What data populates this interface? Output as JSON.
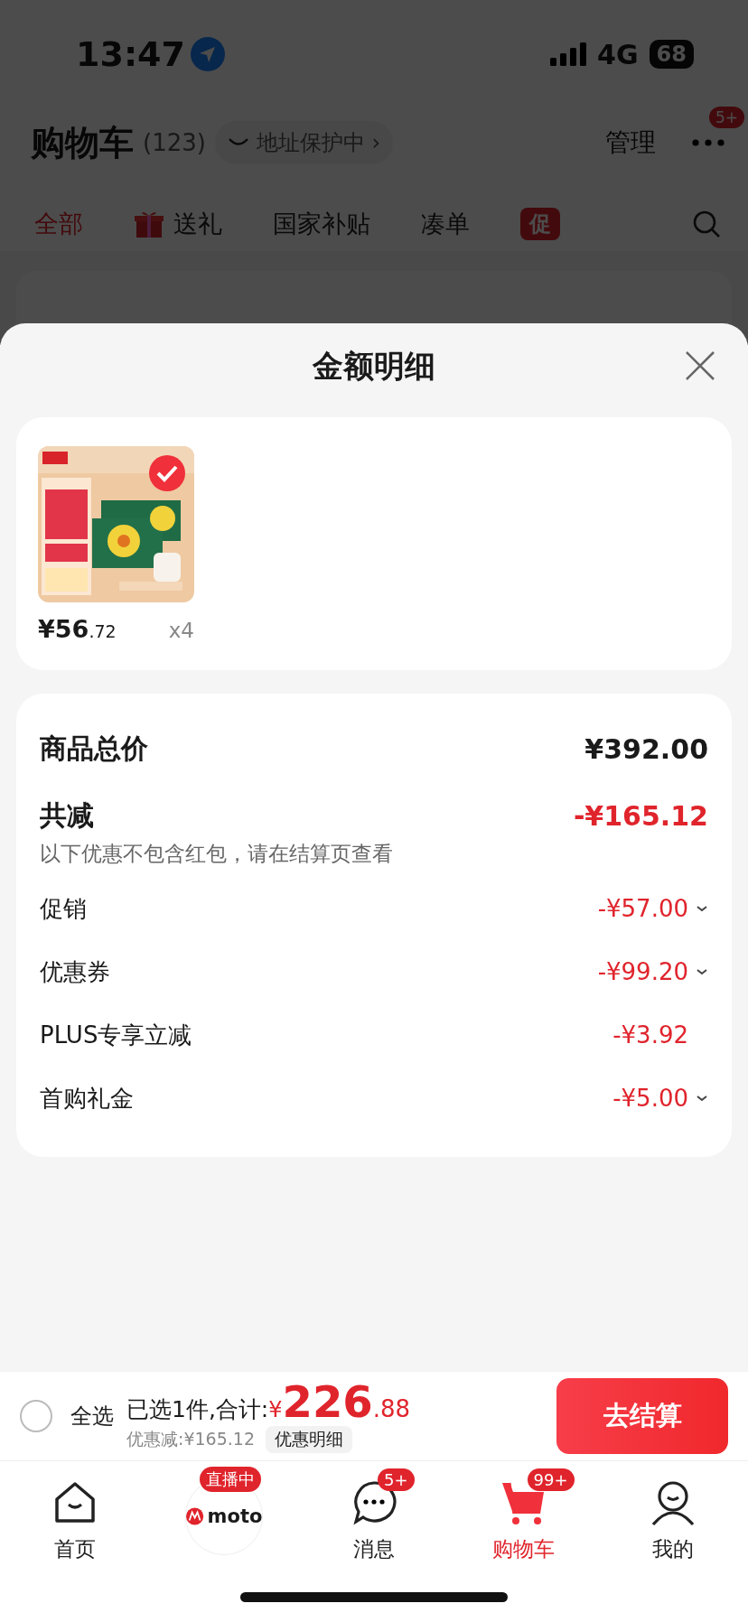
{
  "status_bar": {
    "time": "13:47",
    "network": "4G",
    "battery": "68"
  },
  "header": {
    "title": "购物车",
    "count": "(123)",
    "address_chip": "地址保护中 ›",
    "manage": "管理",
    "more_badge": "5+"
  },
  "filter_tabs": [
    {
      "label": "全部",
      "selected": true,
      "kind": "text"
    },
    {
      "label": "送礼",
      "selected": false,
      "kind": "gift"
    },
    {
      "label": "国家补贴",
      "selected": false,
      "kind": "text"
    },
    {
      "label": "凑单",
      "selected": false,
      "kind": "text"
    },
    {
      "label": "促",
      "selected": false,
      "kind": "promo"
    }
  ],
  "sheet": {
    "title": "金额明细",
    "products": [
      {
        "kind": "picture",
        "checked": true,
        "price_int": "¥56",
        "price_dec": ".72",
        "quantity": "x4"
      }
    ],
    "summary": [
      {
        "kind": "main",
        "label": "商品总价",
        "value": "¥392.00",
        "negative": false,
        "expandable": false
      },
      {
        "kind": "main",
        "label": "共减",
        "value": "-¥165.12",
        "negative": true,
        "expandable": false,
        "note": "以下优惠不包含红包，请在结算页查看"
      },
      {
        "kind": "sub",
        "label": "促销",
        "value": "-¥57.00",
        "negative": true,
        "expandable": true
      },
      {
        "kind": "sub",
        "label": "优惠券",
        "value": "-¥99.20",
        "negative": true,
        "expandable": true
      },
      {
        "kind": "sub",
        "label": "PLUS专享立减",
        "value": "-¥3.92",
        "negative": true,
        "expandable": false
      },
      {
        "kind": "sub",
        "label": "首购礼金",
        "value": "-¥5.00",
        "negative": true,
        "expandable": true
      }
    ]
  },
  "checkout_bar": {
    "select_all": {
      "label": "全选",
      "checked": false
    },
    "total_label": "已选1件,合计:",
    "currency": "¥",
    "total_int": "226",
    "total_dec": ".88",
    "discount": "优惠减:¥165.12",
    "detail_chip": "优惠明细",
    "button": "去结算"
  },
  "tab_bar": [
    {
      "kind": "home",
      "label": "首页",
      "selected": false
    },
    {
      "kind": "live",
      "logo_text": "moto",
      "badge": "直播中",
      "selected": false
    },
    {
      "kind": "chat",
      "label": "消息",
      "badge": "5+",
      "selected": false
    },
    {
      "kind": "cart",
      "label": "购物车",
      "badge": "99+",
      "selected": true
    },
    {
      "kind": "person",
      "label": "我的",
      "selected": false
    }
  ]
}
